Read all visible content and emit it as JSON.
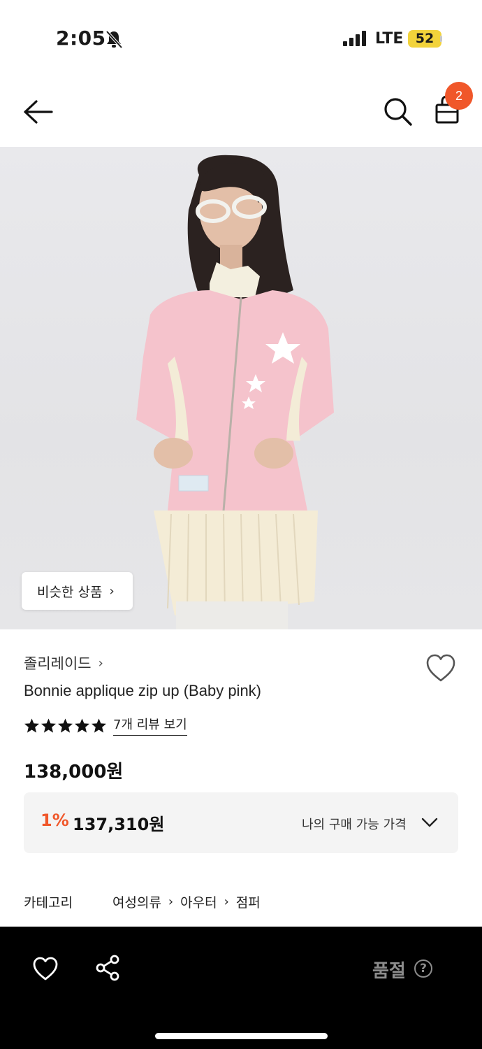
{
  "status_bar": {
    "time": "2:05",
    "network": "LTE",
    "battery": "52",
    "icons": [
      "bell-off-icon",
      "signal-icon"
    ]
  },
  "nav": {
    "cart_count": "2",
    "icons": [
      "back-arrow-icon",
      "search-icon",
      "shopping-bag-icon"
    ]
  },
  "hero": {
    "similar_label": "비슷한 상품",
    "similar_chevron": "›"
  },
  "product": {
    "brand": "졸리레이드",
    "brand_chevron": "›",
    "title": "Bonnie applique zip up (Baby pink)",
    "rating_stars": 5,
    "review_link": "7개 리뷰 보기",
    "price": "138,000원"
  },
  "discount": {
    "percent": "1%",
    "price": "137,310원",
    "label": "나의 구매 가능 가격"
  },
  "category": {
    "label": "카테고리",
    "path": [
      "여성의류",
      "아우터",
      "점퍼"
    ],
    "separator": "›"
  },
  "bottom_bar": {
    "status": "품절",
    "help": "?",
    "icons": [
      "heart-icon",
      "share-icon"
    ]
  },
  "colors": {
    "accent": "#f0572a",
    "discount_bg": "#f4f4f4",
    "bottom_bar_bg": "#000000",
    "muted": "#8c8c8c"
  }
}
